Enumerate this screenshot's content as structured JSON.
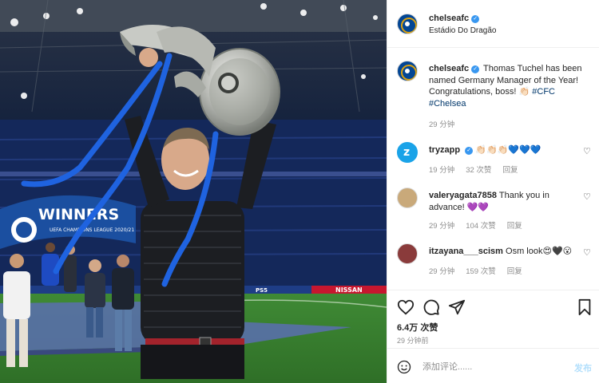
{
  "photo": {
    "banner_text": "WINNERS",
    "banner_sub": "UEFA CHAMPIONS LEAGUE 2020/21",
    "board_right": "NISSAN",
    "board_mid": "PS5"
  },
  "header": {
    "username": "chelseafc",
    "location": "Estádio Do Dragão",
    "avatar_icon": "chelsea-crest-icon"
  },
  "caption": {
    "username": "chelseafc",
    "text": "Thomas Tuchel has been named Germany Manager of the Year! Congratulations, boss! 👏🏻",
    "tags": [
      "#CFC",
      "#Chelsea"
    ],
    "time": "29 分钟"
  },
  "comments": [
    {
      "username": "tryzapp",
      "text": "👏🏻👏🏻👏🏻💙💙💙",
      "time": "19 分钟",
      "likes": "32 次赞",
      "reply": "回复",
      "avatar_color": "#1aa3e8"
    },
    {
      "username": "valeryagata7858",
      "text": "Thank you in advance! 💜💜",
      "time": "29 分钟",
      "likes": "104 次赞",
      "reply": "回复",
      "avatar_color": "#c9a97a"
    },
    {
      "username": "itzayana___scism",
      "text": "Osm look😍🖤😮",
      "time": "29 分钟",
      "likes": "159 次赞",
      "reply": "回复",
      "avatar_color": "#8a3b3b"
    }
  ],
  "actions": {
    "likes": "6.4万 次赞",
    "time_ago": "29 分钟前",
    "icons": [
      "heart-icon",
      "comment-icon",
      "share-icon",
      "save-icon"
    ]
  },
  "add_comment": {
    "placeholder": "添加评论......",
    "post_label": "发布"
  },
  "colors": {
    "verified": "#3897f0",
    "hashtag": "#00376b",
    "muted": "#8e8e8e",
    "post_disabled": "#b2dffc"
  }
}
